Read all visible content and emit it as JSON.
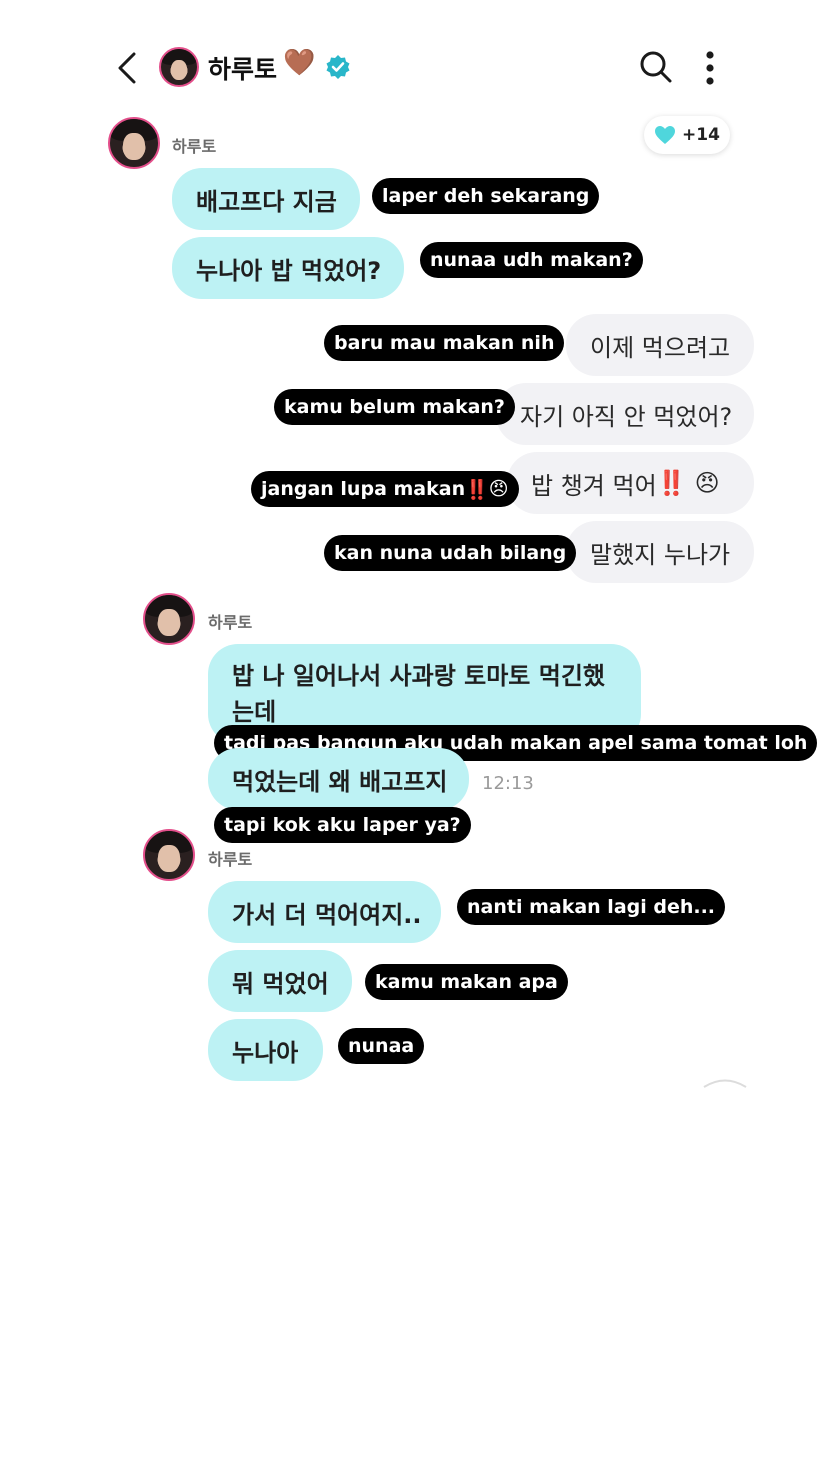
{
  "header": {
    "name": "하루토",
    "emoji": "🤎",
    "verified_color": "#29b6c9"
  },
  "likes": {
    "count": "+14",
    "color": "#4fd6dc"
  },
  "messages": [
    {
      "sender": "하루토",
      "text": "배고프다 지금",
      "tag": "laper deh sekarang"
    },
    {
      "text": "누나아 밥 먹었어?",
      "tag": "nunaa udh makan?"
    },
    {
      "text": "이제 먹으려고",
      "tag": "baru mau makan nih"
    },
    {
      "text": "자기 아직 안 먹었어?",
      "tag": "kamu belum makan?"
    },
    {
      "text": "밥 챙겨 먹어",
      "emphasis": "‼️",
      "emoji": "😠",
      "tag": "jangan lupa makan",
      "tag_emphasis": "‼️",
      "tag_emoji": "😠"
    },
    {
      "text": "말했지 누나가",
      "tag": "kan nuna udah bilang"
    },
    {
      "sender": "하루토",
      "text": "밥 나 일어나서 사과랑 토마토 먹긴했는데",
      "tag": "tadi pas bangun aku udah makan apel sama tomat loh"
    },
    {
      "text": "먹었는데 왜 배고프지",
      "time": "12:13",
      "tag": "tapi kok aku laper ya?"
    },
    {
      "sender": "하루토",
      "text": "가서 더 먹어여지..",
      "tag": "nanti makan lagi deh..."
    },
    {
      "text": "뭐 먹었어",
      "tag": "kamu makan apa"
    },
    {
      "text": "누나아",
      "tag": "nunaa"
    }
  ]
}
